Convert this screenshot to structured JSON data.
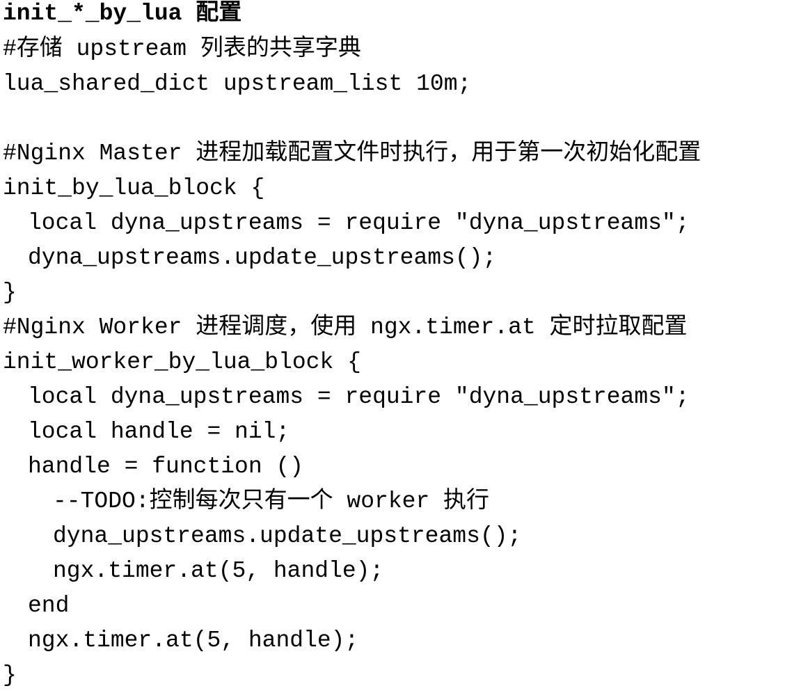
{
  "document": {
    "title": "init_*_by_lua 配置",
    "lines": [
      "#存储 upstream 列表的共享字典",
      "lua_shared_dict upstream_list 10m;",
      "",
      "#Nginx Master 进程加载配置文件时执行，用于第一次初始化配置",
      "init_by_lua_block {",
      "local dyna_upstreams = require \"dyna_upstreams\";",
      "dyna_upstreams.update_upstreams();",
      "}",
      "#Nginx Worker 进程调度，使用 ngx.timer.at 定时拉取配置",
      "init_worker_by_lua_block {",
      "local dyna_upstreams = require \"dyna_upstreams\";",
      "local handle = nil;",
      "handle = function ()",
      "--TODO:控制每次只有一个 worker 执行",
      "dyna_upstreams.update_upstreams();",
      "ngx.timer.at(5, handle);",
      "end",
      "ngx.timer.at(5, handle);",
      "}"
    ]
  }
}
